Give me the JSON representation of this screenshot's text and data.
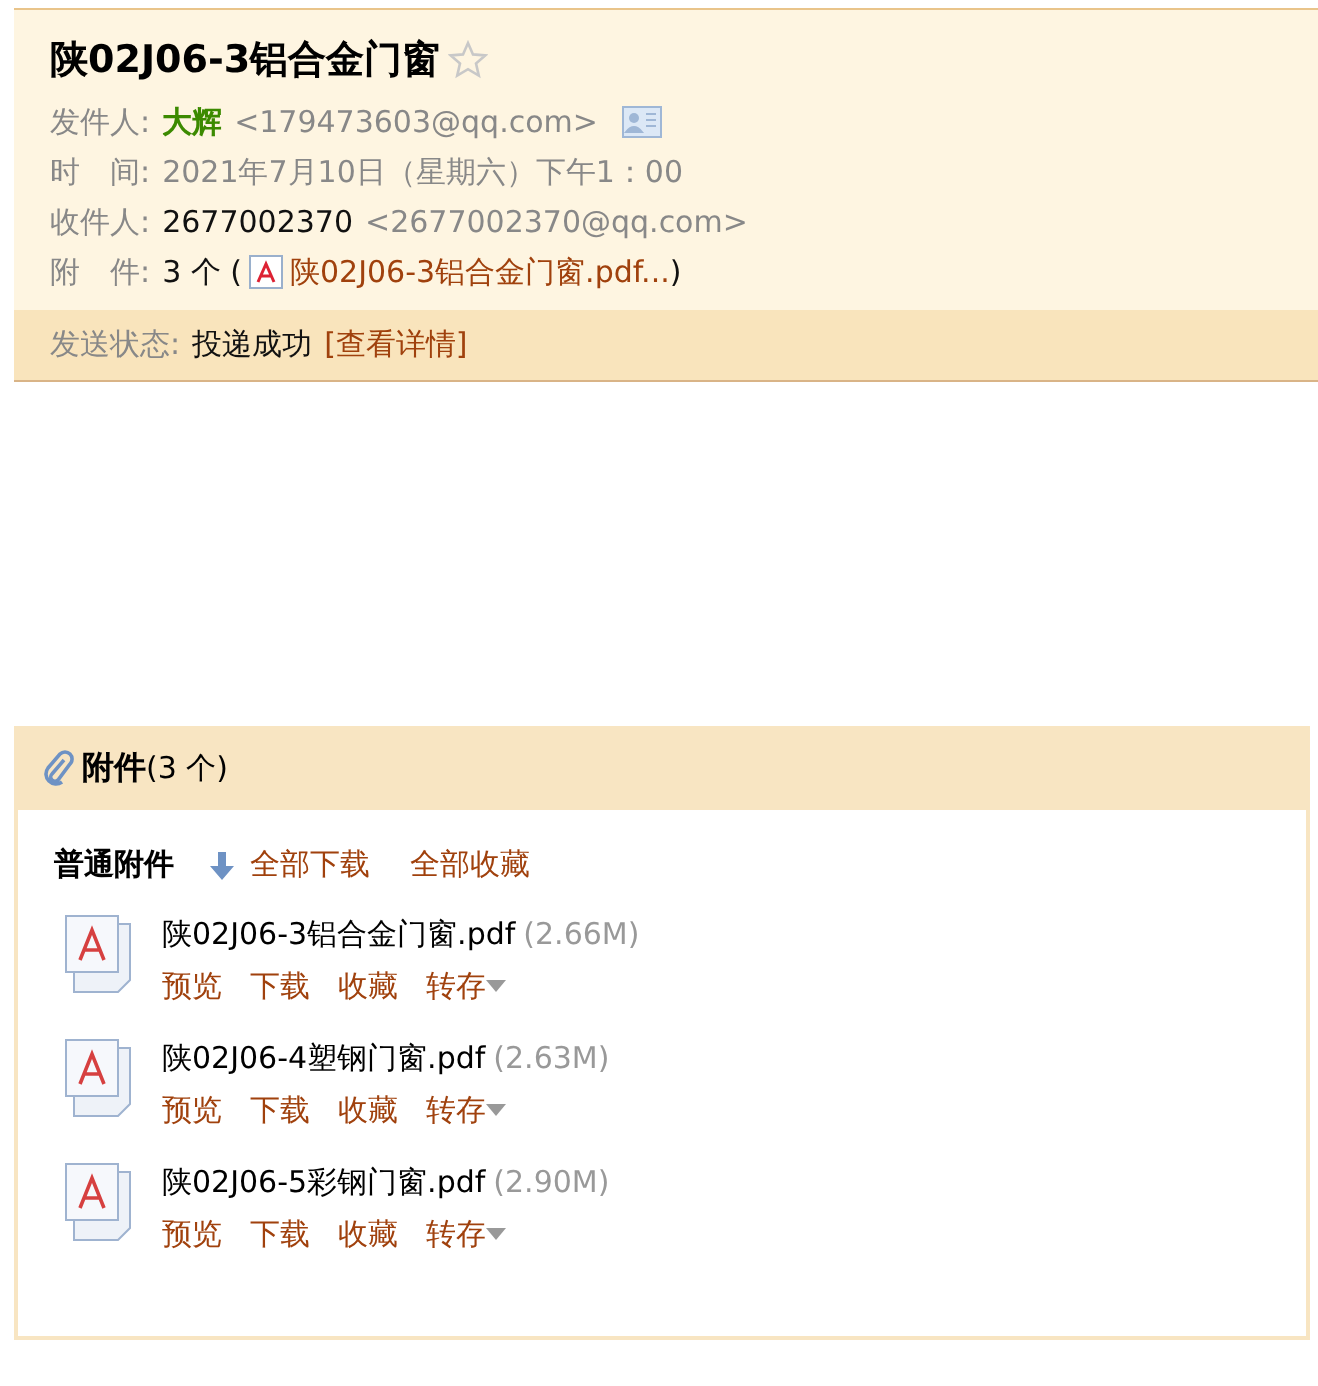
{
  "mail": {
    "subject": "陕02J06-3铝合金门窗",
    "starred": false,
    "fields": [
      {
        "kind": "sender",
        "label": "发件人:",
        "name": "大辉",
        "address": "<179473603@qq.com>"
      },
      {
        "kind": "time",
        "label": "时　间:",
        "value": "2021年7月10日（星期六）下午1：00"
      },
      {
        "kind": "recipient",
        "label": "收件人:",
        "name": "2677002370",
        "address": "<2677002370@qq.com>"
      },
      {
        "kind": "attachments",
        "label": "附　件:",
        "count": "3 个 (",
        "file": "陕02J06-3铝合金门窗.pdf...",
        "close": ")"
      }
    ],
    "status": {
      "label": "发送状态:",
      "value": "投递成功",
      "link": "[查看详情]"
    }
  },
  "attachments": {
    "title": "附件",
    "count": "(3 个)",
    "group": "普通附件",
    "download_all": "全部下载",
    "save_all": "全部收藏",
    "files": [
      {
        "name": "陕02J06-3铝合金门窗.pdf",
        "size": "(2.66M)",
        "actions": [
          "预览",
          "下载",
          "收藏",
          "转存"
        ]
      },
      {
        "name": "陕02J06-4塑钢门窗.pdf",
        "size": "(2.63M)",
        "actions": [
          "预览",
          "下载",
          "收藏",
          "转存"
        ]
      },
      {
        "name": "陕02J06-5彩钢门窗.pdf",
        "size": "(2.90M)",
        "actions": [
          "预览",
          "下载",
          "收藏",
          "转存"
        ]
      }
    ]
  }
}
